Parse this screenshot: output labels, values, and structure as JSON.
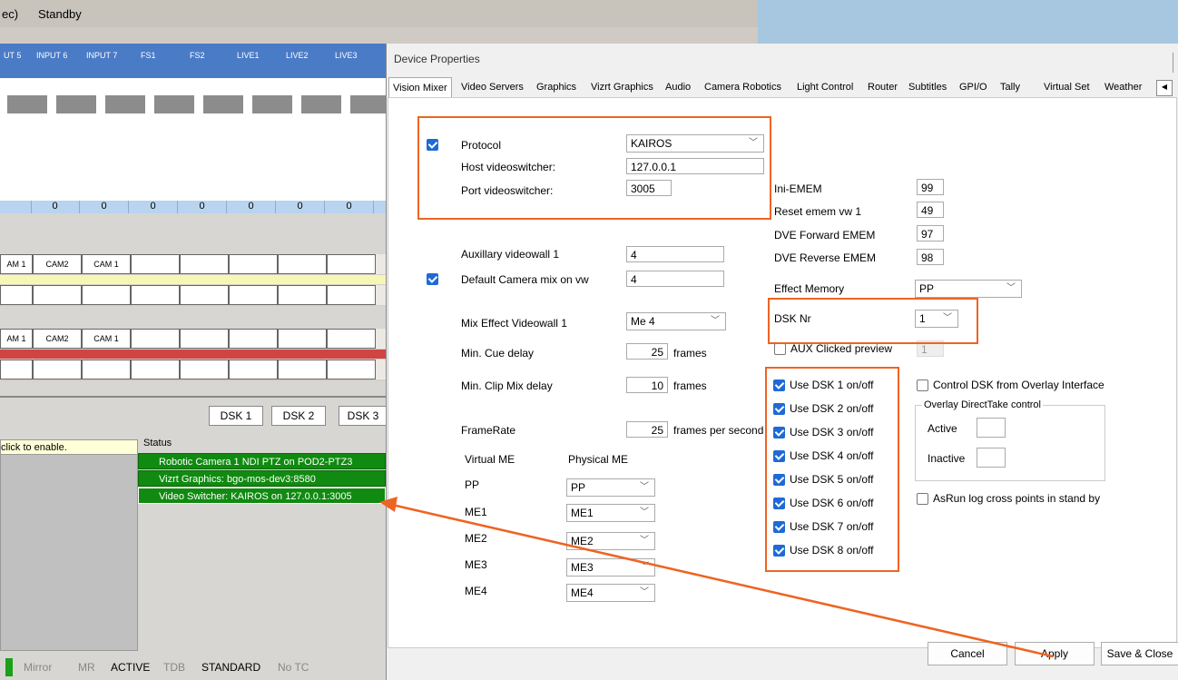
{
  "topbar": {
    "left_text": "ec)",
    "standby": "Standby"
  },
  "inputs": [
    "UT 5",
    "INPUT 6",
    "INPUT 7",
    "FS1",
    "FS2",
    "LIVE1",
    "LIVE2",
    "LIVE3"
  ],
  "zeros": [
    "0",
    "0",
    "0",
    "0",
    "0",
    "0",
    "0"
  ],
  "cam_rows": [
    [
      "AM 1",
      "CAM2",
      "CAM 1"
    ],
    [
      "AM 1",
      "CAM2",
      "CAM 1"
    ]
  ],
  "dsk_buttons": [
    "DSK 1",
    "DSK 2",
    "DSK 3"
  ],
  "enable_text": "click to enable.",
  "status_label": "Status",
  "status_items": [
    "Robotic Camera 1 NDI PTZ on POD2-PTZ3",
    "Vizrt Graphics: bgo-mos-dev3:8580",
    "Video Switcher: KAIROS on 127.0.0.1:3005"
  ],
  "bottombar": {
    "mirror": "Mirror",
    "mr": "MR",
    "active": "ACTIVE",
    "tdb": "TDB",
    "standard": "STANDARD",
    "notc": "No TC"
  },
  "dialog": {
    "title": "Device Properties",
    "tabs": [
      "Vision Mixer",
      "Video Servers",
      "Graphics",
      "Vizrt Graphics",
      "Audio",
      "Camera Robotics",
      "Light Control",
      "Router",
      "Subtitles",
      "GPI/O",
      "Tally",
      "Virtual Set",
      "Weather"
    ],
    "protocol_label": "Protocol",
    "protocol_value": "KAIROS",
    "host_label": "Host videoswitcher:",
    "host_value": "127.0.0.1",
    "port_label": "Port videoswitcher:",
    "port_value": "3005",
    "aux_label": "Auxillary videowall 1",
    "aux_value": "4",
    "defcam_label": "Default Camera mix on vw",
    "defcam_value": "4",
    "mixeff_label": "Mix Effect Videowall 1",
    "mixeff_value": "Me 4",
    "cue_label": "Min. Cue delay",
    "cue_value": "25",
    "cue_unit": "frames",
    "clip_label": "Min. Clip Mix delay",
    "clip_value": "10",
    "clip_unit": "frames",
    "framerate_label": "FrameRate",
    "framerate_value": "25",
    "framerate_unit": "frames per second",
    "virtual_me": "Virtual ME",
    "physical_me": "Physical ME",
    "me_map": [
      {
        "v": "PP",
        "p": "PP"
      },
      {
        "v": "ME1",
        "p": "ME1"
      },
      {
        "v": "ME2",
        "p": "ME2"
      },
      {
        "v": "ME3",
        "p": "ME3"
      },
      {
        "v": "ME4",
        "p": "ME4"
      }
    ],
    "emem": [
      {
        "label": "Ini-EMEM",
        "value": "99"
      },
      {
        "label": "Reset emem vw 1",
        "value": "49"
      },
      {
        "label": "DVE Forward EMEM",
        "value": "97"
      },
      {
        "label": "DVE Reverse EMEM",
        "value": "98"
      }
    ],
    "effect_mem_label": "Effect Memory",
    "effect_mem_value": "PP",
    "dsknr_label": "DSK Nr",
    "dsknr_value": "1",
    "aux_clicked_label": "AUX Clicked preview",
    "aux_clicked_value": "1",
    "use_dsk": [
      "Use DSK 1 on/off",
      "Use DSK 2 on/off",
      "Use DSK 3 on/off",
      "Use DSK 4 on/off",
      "Use DSK 5 on/off",
      "Use DSK 6 on/off",
      "Use DSK 7 on/off",
      "Use DSK 8 on/off"
    ],
    "control_dsk_label": "Control DSK from Overlay Interface",
    "overlay_group": "Overlay DirectTake control",
    "active_label": "Active",
    "inactive_label": "Inactive",
    "asrun_label": "AsRun log cross points in stand by",
    "cancel": "Cancel",
    "apply": "Apply",
    "save_close": "Save & Close"
  },
  "accent_color": "#ee6422"
}
